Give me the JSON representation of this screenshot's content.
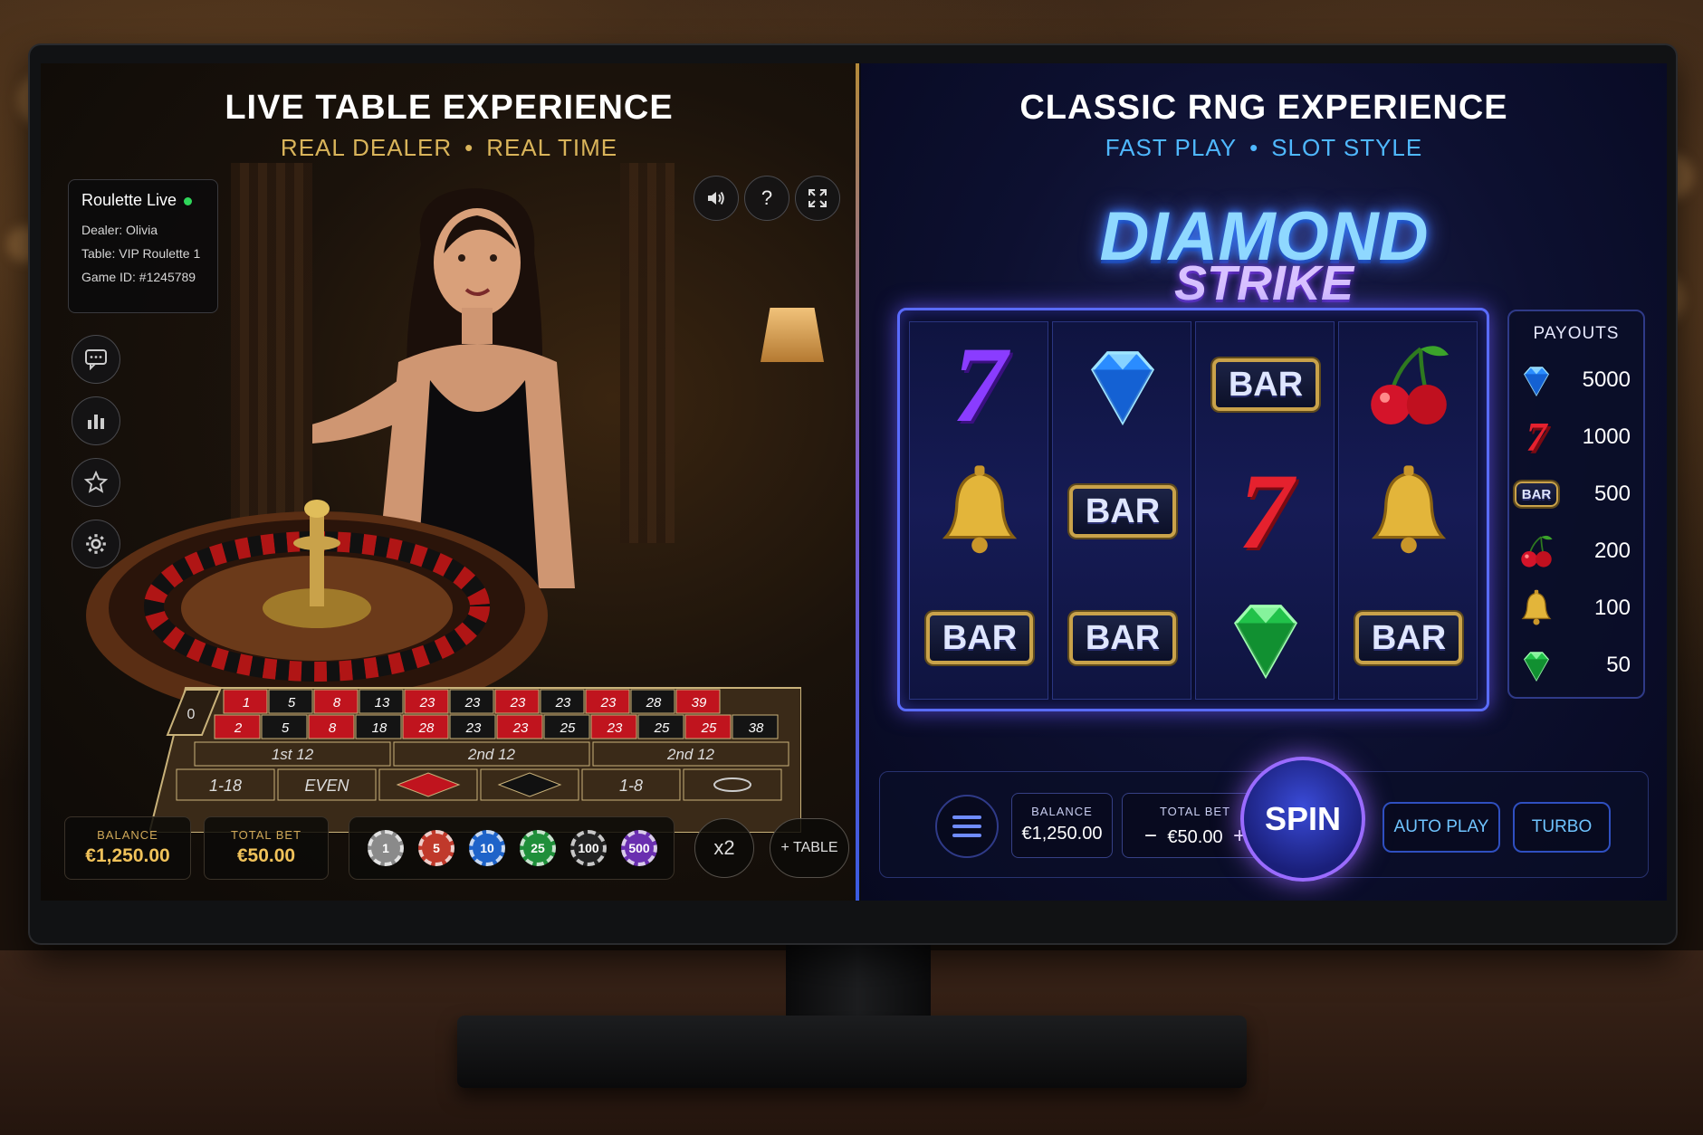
{
  "left_panel": {
    "title": "LIVE TABLE EXPERIENCE",
    "subtitle_a": "REAL DEALER",
    "subtitle_b": "REAL TIME",
    "subtitle_color": "#d9b45a",
    "info": {
      "game_name": "Roulette Live",
      "dealer": "Dealer: Olivia",
      "table": "Table: VIP Roulette 1",
      "game_id": "Game ID: #1245789"
    },
    "side_icons": [
      "chat-icon",
      "stats-icon",
      "star-icon",
      "gear-icon"
    ],
    "top_icons": [
      "volume-icon",
      "help-icon",
      "fullscreen-icon"
    ],
    "help_glyph": "?",
    "betting_grid": {
      "row1": [
        "1",
        "5",
        "8",
        "13",
        "23",
        "23",
        "23",
        "23",
        "23",
        "28",
        "39"
      ],
      "row2": [
        "2",
        "5",
        "8",
        "18",
        "28",
        "23",
        "23",
        "25",
        "23",
        "25",
        "25",
        "38"
      ],
      "zero": "0",
      "dozens": [
        "1st 12",
        "2nd 12",
        "2nd 12"
      ],
      "outside": [
        "1-18",
        "EVEN",
        "1-8"
      ]
    },
    "balance_label": "BALANCE",
    "balance_value": "€1,250.00",
    "total_bet_label": "TOTAL BET",
    "total_bet_value": "€50.00",
    "chips": [
      {
        "value": "1",
        "color": "#8a8a8a"
      },
      {
        "value": "5",
        "color": "#c0392b"
      },
      {
        "value": "10",
        "color": "#1e63c9"
      },
      {
        "value": "25",
        "color": "#1f8f3a"
      },
      {
        "value": "100",
        "color": "#222222"
      },
      {
        "value": "500",
        "color": "#6a2fb0"
      }
    ],
    "multiplier_label": "x2",
    "add_table_label": "+ TABLE"
  },
  "right_panel": {
    "title": "CLASSIC RNG EXPERIENCE",
    "subtitle_a": "FAST PLAY",
    "subtitle_b": "SLOT STYLE",
    "subtitle_color": "#4fb8ff",
    "logo_line1": "DIAMOND",
    "logo_line2": "STRIKE",
    "reels": [
      [
        "seven-purple",
        "bell",
        "bar"
      ],
      [
        "diamond-blue",
        "bar",
        "bar"
      ],
      [
        "bar",
        "seven-red",
        "diamond-green"
      ],
      [
        "cherry",
        "bell",
        "bar"
      ]
    ],
    "bar_text": "BAR",
    "seven_text": "7",
    "payouts_title": "PAYOUTS",
    "payouts": [
      {
        "icon": "diamond-blue",
        "value": "5000"
      },
      {
        "icon": "seven-red",
        "value": "1000"
      },
      {
        "icon": "bar",
        "value": "500"
      },
      {
        "icon": "cherry",
        "value": "200"
      },
      {
        "icon": "bell",
        "value": "100"
      },
      {
        "icon": "diamond-green",
        "value": "50"
      }
    ],
    "balance_label": "BALANCE",
    "balance_value": "€1,250.00",
    "total_bet_label": "TOTAL BET",
    "total_bet_value": "€50.00",
    "minus": "−",
    "plus": "+",
    "spin_label": "SPIN",
    "autoplay_label": "AUTO PLAY",
    "turbo_label": "TURBO"
  }
}
